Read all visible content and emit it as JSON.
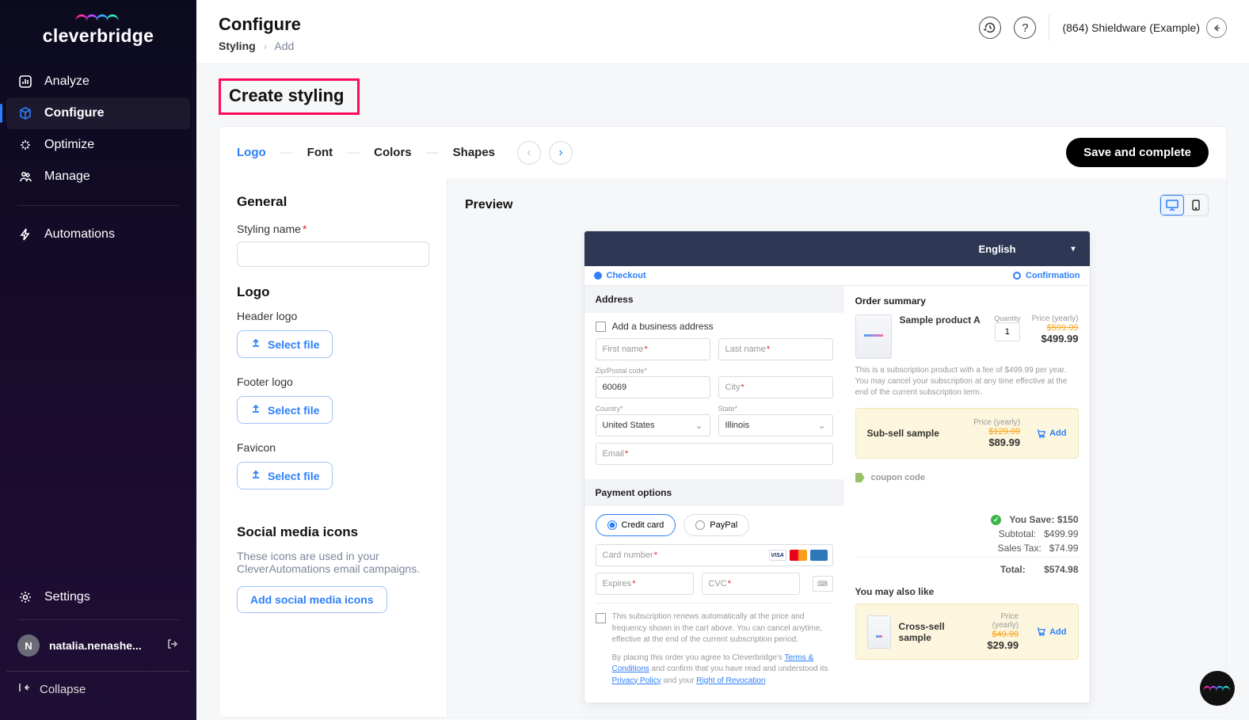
{
  "brand": {
    "name": "cleverbridge"
  },
  "sidebar": {
    "items": [
      {
        "label": "Analyze"
      },
      {
        "label": "Configure"
      },
      {
        "label": "Optimize"
      },
      {
        "label": "Manage"
      }
    ],
    "automations": "Automations",
    "settings": "Settings",
    "user": {
      "initial": "N",
      "name": "natalia.nenashe..."
    },
    "collapse": "Collapse"
  },
  "header": {
    "title": "Configure",
    "breadcrumb": {
      "a": "Styling",
      "b": "Add"
    },
    "account": "(864) Shieldware (Example)"
  },
  "section": {
    "title": "Create styling"
  },
  "wizard": {
    "steps": [
      "Logo",
      "Font",
      "Colors",
      "Shapes"
    ],
    "save": "Save and complete"
  },
  "form": {
    "general": "General",
    "styling_name_label": "Styling name",
    "logo_title": "Logo",
    "header_logo": "Header logo",
    "footer_logo": "Footer logo",
    "favicon": "Favicon",
    "select_file": "Select file",
    "social_title": "Social media icons",
    "social_hint": "These icons are used in your CleverAutomations email campaigns.",
    "add_social": "Add social media icons"
  },
  "preview": {
    "title": "Preview",
    "language": "English",
    "progress": {
      "checkout": "Checkout",
      "confirmation": "Confirmation"
    },
    "address": {
      "title": "Address",
      "add_business": "Add a business address",
      "first_name": "First name",
      "last_name": "Last name",
      "zip": "Zip/Postal code",
      "zip_value": "60069",
      "city": "City",
      "country": "Country",
      "country_value": "United States",
      "state": "State",
      "state_value": "Illinois",
      "email": "Email"
    },
    "payment": {
      "title": "Payment options",
      "credit": "Credit card",
      "paypal": "PayPal",
      "card_number": "Card number",
      "expires": "Expires",
      "cvc": "CVC"
    },
    "fineprint": {
      "line1": "This subscription renews automatically at the price and frequency shown in the cart above. You can cancel anytime, effective at the end of the current subscription period.",
      "line2a": "By placing this order you agree to Cleverbridge's ",
      "terms": "Terms & Conditions",
      "line2b": " and confirm that you have read and understood its ",
      "privacy": "Privacy Policy",
      "line2c": " and your ",
      "revocation": "Right of Revocation"
    },
    "order": {
      "title": "Order summary",
      "product_name": "Sample product A",
      "quantity_label": "Quantity",
      "quantity": "1",
      "price_label": "Price (yearly)",
      "old_price": "$599.99",
      "price": "$499.99",
      "desc": "This is a subscription product with a fee of $499.99 per year. You may cancel your subscription at any time effective at the end of the current subscription term.",
      "subsell": {
        "name": "Sub-sell sample",
        "price_label": "Price (yearly)",
        "old": "$129.99",
        "price": "$89.99",
        "add": "Add"
      },
      "coupon": "coupon code",
      "you_save": "You Save: $150",
      "subtotal_label": "Subtotal:",
      "subtotal": "$499.99",
      "tax_label": "Sales Tax:",
      "tax": "$74.99",
      "total_label": "Total:",
      "total": "$574.98"
    },
    "cross": {
      "title": "You may also like",
      "name": "Cross-sell sample",
      "price_label": "Price (yearly)",
      "old": "$49.99",
      "price": "$29.99",
      "add": "Add"
    }
  }
}
